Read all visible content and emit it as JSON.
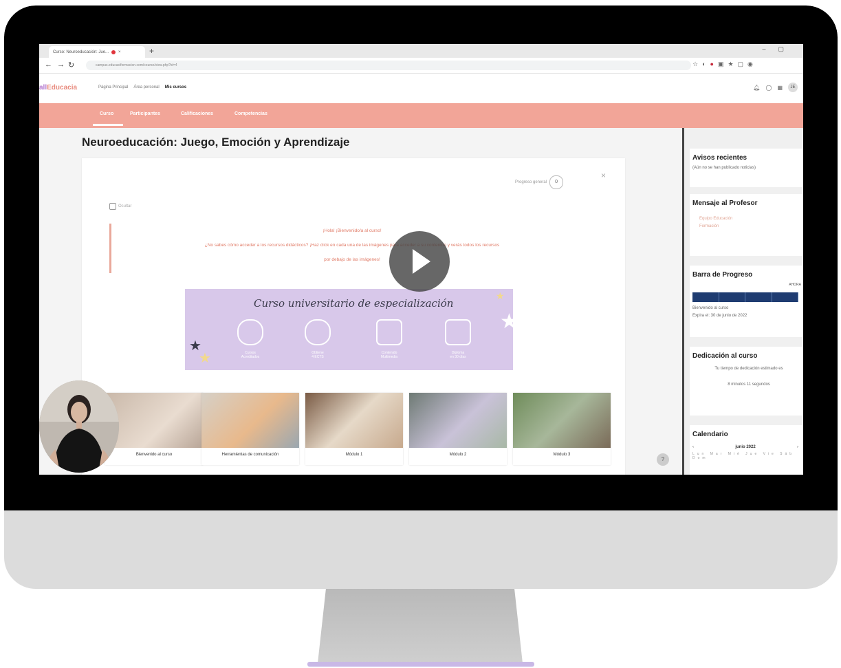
{
  "browser": {
    "tab_title": "Curso: Neuroeducación: Jue...",
    "url": "campus.educaciformacion.com/course/view.php?id=4"
  },
  "site": {
    "logo_prefix": "all",
    "logo_rest": "Educacia",
    "nav": [
      "Página Principal",
      "Área personal",
      "Mis cursos"
    ]
  },
  "course_nav": [
    "Curso",
    "Participantes",
    "Calificaciones",
    "Competencias"
  ],
  "course": {
    "title": "Neuroeducación: Juego, Emoción y Aprendizaje",
    "progress_label": "Progreso general",
    "progress_value": "0",
    "hide_label": "Ocultar",
    "welcome_line1": "¡Hola! ¡Bienvenido/a al curso!",
    "welcome_line2": "¿No sabes cómo acceder a los recursos didácticos? ¡Haz click en cada una de las imágenes para acceder a su contenido y verás todos los recursos",
    "welcome_line3": "por debajo de las imágenes!"
  },
  "banner": {
    "title": "Curso universitario de especialización",
    "features": [
      {
        "line1": "Cursos",
        "line2": "Acreditados"
      },
      {
        "line1": "Obtiene",
        "line2": "4 ECTS"
      },
      {
        "line1": "Contenido",
        "line2": "Multimedia"
      },
      {
        "line1": "Diploma",
        "line2": "en 30 días"
      }
    ]
  },
  "modules": [
    "Bienvenido al curso",
    "Herramientas de comunicación",
    "Módulo 1",
    "Módulo 2",
    "Módulo 3"
  ],
  "sidebar": {
    "avisos_title": "Avisos recientes",
    "avisos_text": "(Aún no se han publicado noticias)",
    "mensaje_title": "Mensaje al Profesor",
    "mensaje_name": "Equipo Educación",
    "mensaje_name2": "Formación",
    "barra_title": "Barra de Progreso",
    "barra_right": "AHORA",
    "barra_item": "Bienvenido al curso",
    "barra_date": "Expira el: 30 de junio de 2022",
    "dedicacion_title": "Dedicación al curso",
    "dedicacion_text": "Tu tiempo de dedicación estimado es",
    "dedicacion_time": "8 minutos 11 segundos",
    "calendario_title": "Calendario",
    "calendario_month": "junio 2022",
    "calendario_days": "Lun Mar Mié Jue Vie Sáb Dom"
  }
}
